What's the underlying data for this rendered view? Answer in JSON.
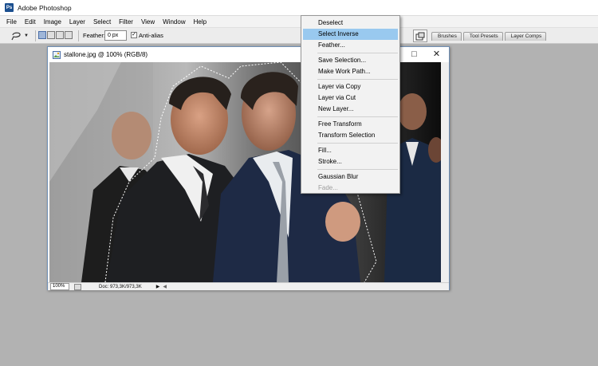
{
  "app": {
    "title": "Adobe Photoshop",
    "icon": "photoshop-app-icon"
  },
  "menubar": [
    "File",
    "Edit",
    "Image",
    "Layer",
    "Select",
    "Filter",
    "View",
    "Window",
    "Help"
  ],
  "options_bar": {
    "feather_label": "Feather:",
    "feather_value": "0 px",
    "antialias_label": "Anti-alias",
    "antialias_checked": true,
    "palette_tabs": [
      "Brushes",
      "Tool Presets",
      "Layer Comps"
    ]
  },
  "document": {
    "title": "stallone.jpg @ 100% (RGB/8)",
    "zoom": "100%",
    "doc_size": "Doc: 973,3K/973,3K"
  },
  "context_menu": {
    "items": [
      {
        "label": "Deselect"
      },
      {
        "label": "Select Inverse",
        "highlighted": true
      },
      {
        "label": "Feather..."
      },
      {
        "separator": true
      },
      {
        "label": "Save Selection..."
      },
      {
        "label": "Make Work Path..."
      },
      {
        "separator": true
      },
      {
        "label": "Layer via Copy"
      },
      {
        "label": "Layer via Cut"
      },
      {
        "label": "New Layer..."
      },
      {
        "separator": true
      },
      {
        "label": "Free Transform"
      },
      {
        "label": "Transform Selection"
      },
      {
        "separator": true
      },
      {
        "label": "Fill..."
      },
      {
        "label": "Stroke..."
      },
      {
        "separator": true
      },
      {
        "label": "Gaussian Blur"
      },
      {
        "label": "Fade...",
        "disabled": true
      }
    ]
  },
  "colors": {
    "workspace": "#b2b2b2",
    "menu_highlight": "#99c9ef",
    "window_border": "#6f8fb5"
  }
}
